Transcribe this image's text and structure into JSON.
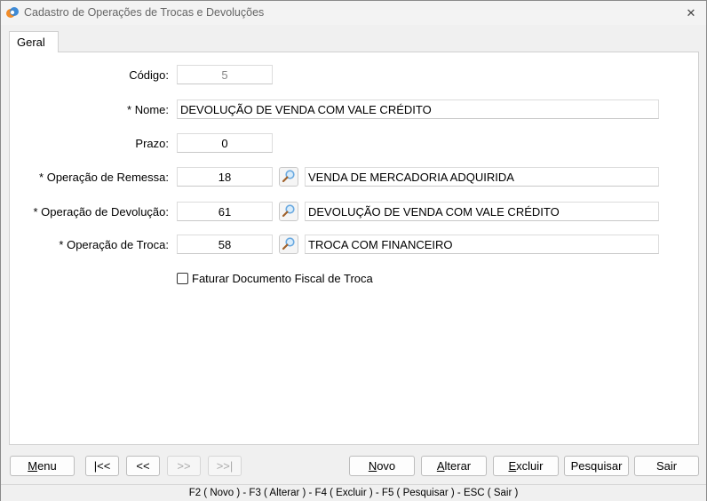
{
  "window": {
    "title": "Cadastro de Operações de Trocas e Devoluções",
    "close_symbol": "✕"
  },
  "tabs": [
    {
      "label": "Geral",
      "active": true
    }
  ],
  "form": {
    "codigo": {
      "label": "Código:",
      "value": "5"
    },
    "nome": {
      "label": "* Nome:",
      "value": "DEVOLUÇÃO DE VENDA COM VALE CRÉDITO"
    },
    "prazo": {
      "label": "Prazo:",
      "value": "0"
    },
    "remessa": {
      "label": "* Operação de Remessa:",
      "code": "18",
      "description": "VENDA DE MERCADORIA ADQUIRIDA"
    },
    "devolucao": {
      "label": "* Operação de Devolução:",
      "code": "61",
      "description": "DEVOLUÇÃO DE VENDA COM VALE CRÉDITO"
    },
    "troca": {
      "label": "* Operação de Troca:",
      "code": "58",
      "description": "TROCA COM FINANCEIRO"
    },
    "faturar": {
      "label": "Faturar Documento Fiscal de Troca",
      "checked": false
    }
  },
  "buttons": {
    "menu": {
      "first": "M",
      "rest": "enu"
    },
    "first_record": "|<<",
    "prev_record": "<<",
    "next_record": ">>",
    "last_record": ">>|",
    "novo": {
      "first": "N",
      "rest": "ovo"
    },
    "alterar": {
      "first": "A",
      "rest": "lterar"
    },
    "excluir": {
      "first": "E",
      "rest": "xcluir"
    },
    "pesquisar": "Pesquisar",
    "sair": "Sair"
  },
  "status": {
    "shortcuts": "F2 ( Novo )  -  F3 ( Alterar )  -  F4 ( Excluir )  -  F5 ( Pesquisar )  -  ESC ( Sair )"
  },
  "icons": {
    "app": "app-logo-icon",
    "lookup": "magnifier-icon",
    "close": "close-icon"
  },
  "colors": {
    "logo_orange": "#f28c28",
    "logo_blue": "#2a7fd4",
    "lookup_lens": "#6aa9e0"
  }
}
